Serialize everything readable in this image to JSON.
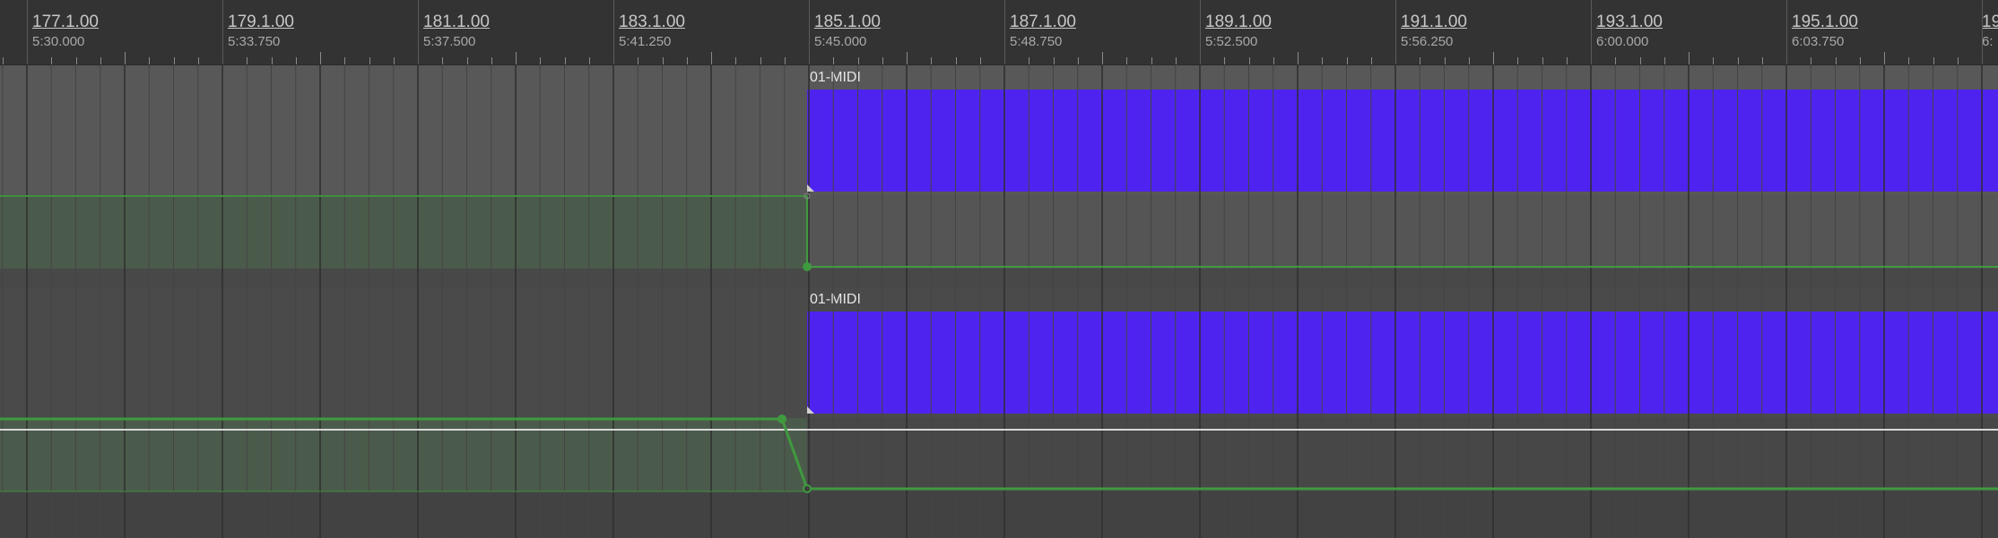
{
  "ruler": {
    "marks": [
      {
        "bar": "177.1.00",
        "time": "5:30.000"
      },
      {
        "bar": "179.1.00",
        "time": "5:33.750"
      },
      {
        "bar": "181.1.00",
        "time": "5:37.500"
      },
      {
        "bar": "183.1.00",
        "time": "5:41.250"
      },
      {
        "bar": "185.1.00",
        "time": "5:45.000"
      },
      {
        "bar": "187.1.00",
        "time": "5:48.750"
      },
      {
        "bar": "189.1.00",
        "time": "5:52.500"
      },
      {
        "bar": "191.1.00",
        "time": "5:56.250"
      },
      {
        "bar": "193.1.00",
        "time": "6:00.000"
      },
      {
        "bar": "195.1.00",
        "time": "6:03.750"
      },
      {
        "bar": "19",
        "time": "6:"
      }
    ]
  },
  "tracks": [
    {
      "item_name": "01-MIDI"
    },
    {
      "item_name": "01-MIDI"
    }
  ],
  "colors": {
    "midi_item": "#4f23ef",
    "envelope": "#3f9a3f",
    "envelope_fill": "#4b5b4b",
    "track_bg": "#585858",
    "ruler_bg": "#333333"
  }
}
